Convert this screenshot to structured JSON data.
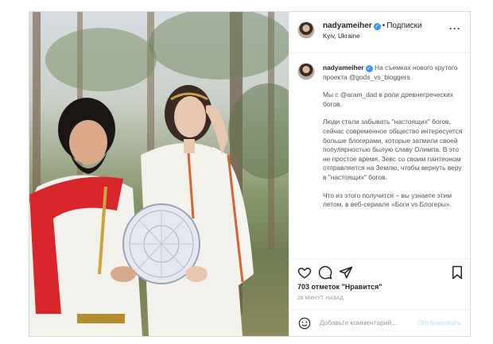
{
  "post": {
    "username": "nadyameiher",
    "follow_label": "Подписки",
    "location": "Kyiv, Ukraine",
    "more_icon": "more-icon",
    "caption_user": "nadyameiher",
    "caption_lines": {
      "p1": "На съемках нового крутого проекта @gods_vs_bloggers.",
      "p2": "Мы с @aram_dad в роли древнегреческих богов.",
      "p3": "Люди стали забывать \"настоящих\" богов, сейчас современное общество интересуется больше блогерами, которые затмили своей популярностью былую славу Олимпа. В это не простое время, Зевс со своим пантеоном отправляется на Землю, чтобы вернуть веру в \"настоящих\" богов.",
      "p4": "Что из этого получится – вы узнаете этим летом, в веб-сериале «Боги vs Блогеры»."
    },
    "likes": "703 отметок \"Нравится\"",
    "time": "28 МИНУТ НАЗАД",
    "comment_placeholder": "Добавьте комментарий...",
    "publish_label": "Опубликовать"
  },
  "colors": {
    "verified": "#3897f0",
    "publish": "#b2dffc",
    "border": "#dbdbdb"
  },
  "icons": [
    "verified-icon",
    "heart-icon",
    "comment-icon",
    "share-icon",
    "bookmark-icon",
    "smile-icon",
    "more-icon"
  ]
}
